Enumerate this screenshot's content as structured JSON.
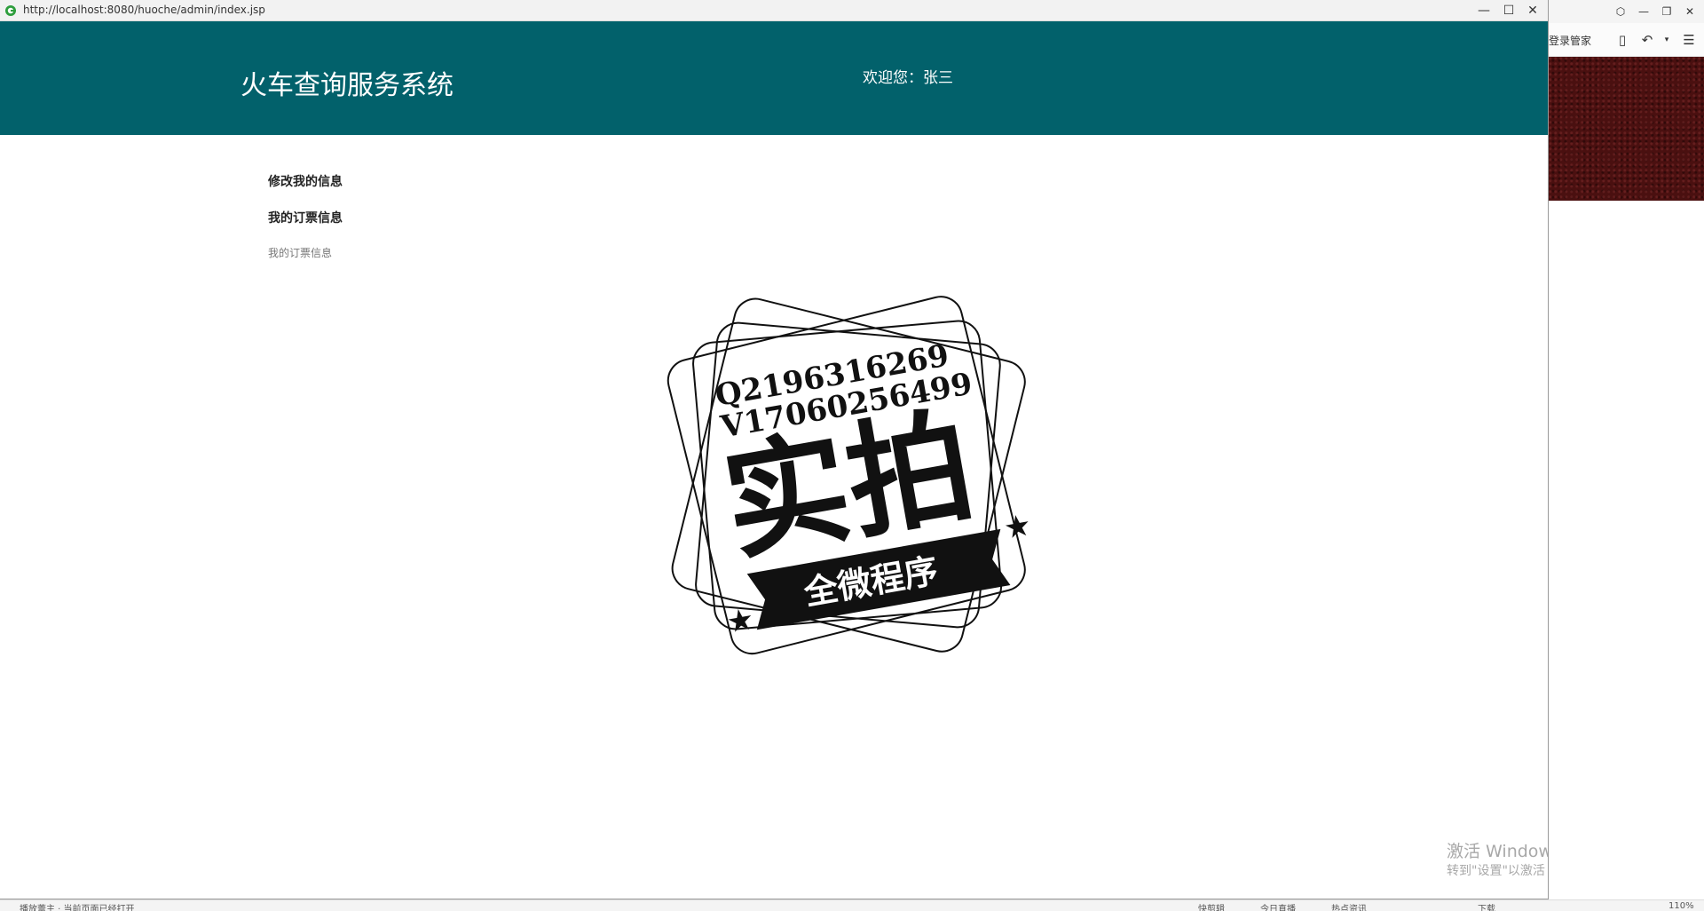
{
  "window": {
    "url": "http://localhost:8080/huoche/admin/index.jsp",
    "minimize_glyph": "—",
    "maximize_glyph": "☐",
    "close_glyph": "✕"
  },
  "header": {
    "title": "火车查询服务系统",
    "welcome_label": "欢迎您：",
    "username": "张三"
  },
  "menu": {
    "items": [
      {
        "label": "修改我的信息"
      },
      {
        "label": "我的订票信息",
        "children": [
          "我的订票信息"
        ]
      }
    ]
  },
  "watermark": {
    "line1": "Q2196316269",
    "line2": "V17060256499",
    "main": "实拍",
    "banner": "全微程序"
  },
  "activation": {
    "title": "激活 Windows",
    "subtitle": "转到\"设置\"以激活 Windows。"
  },
  "background_browser": {
    "login_manager": "登录管家"
  },
  "statusbar": {
    "left_text": "播放蕾主 · 当前页面已经打开",
    "items": [
      "快剪辑",
      "今日直播",
      "热点资讯",
      "下载",
      "110%"
    ]
  },
  "colors": {
    "header_bg": "#02616b",
    "header_text": "#ffffff"
  }
}
